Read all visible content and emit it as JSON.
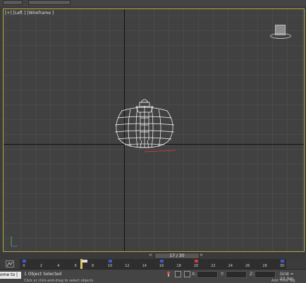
{
  "viewport": {
    "label": "[+] [Left ] [Wireframe ]"
  },
  "time_slider": {
    "frame_display": "17 / 30",
    "prev_label": "<",
    "next_label": ">"
  },
  "trackbar": {
    "ticks": [
      "0",
      "2",
      "4",
      "6",
      "8",
      "10",
      "12",
      "14",
      "16",
      "18",
      "20",
      "22",
      "24",
      "26",
      "28",
      "30"
    ],
    "current_frame": 7
  },
  "status": {
    "welcome_text": "ome to |",
    "selection": "1 Object Selected",
    "prompt": "Click or click-and-drag to select objects",
    "coord_x_label": "X:",
    "coord_y_label": "Y:",
    "coord_z_label": "Z:",
    "grid": "Grid = 10.0m",
    "add_time_tag": "Add Time Tag"
  },
  "colors": {
    "viewport_border": "#b6a840",
    "selected_wire": "#ffffff",
    "key_blue": "#3a5ad8",
    "key_red": "#d83a3a"
  }
}
